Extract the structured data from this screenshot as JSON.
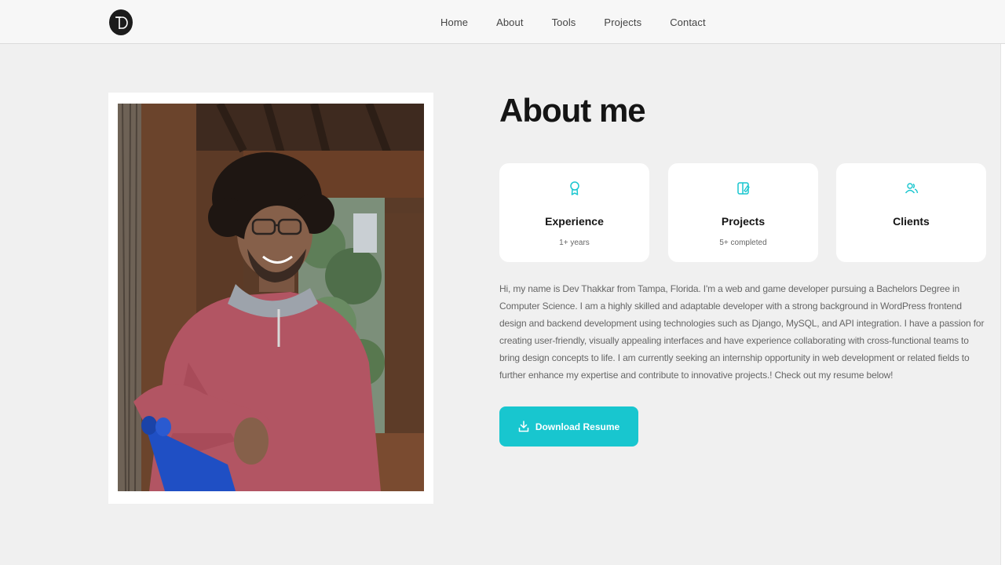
{
  "nav": {
    "logo_text": "D",
    "links": [
      "Home",
      "About",
      "Tools",
      "Projects",
      "Contact"
    ]
  },
  "about": {
    "title": "About me",
    "cards": [
      {
        "icon": "award-icon",
        "title": "Experience",
        "subtitle": "1+ years"
      },
      {
        "icon": "projects-icon",
        "title": "Projects",
        "subtitle": "5+ completed"
      },
      {
        "icon": "users-icon",
        "title": "Clients",
        "subtitle": ""
      }
    ],
    "bio": "Hi, my name is Dev Thakkar from Tampa, Florida. I'm a web and game developer pursuing a Bachelors Degree in Computer Science. I am a highly skilled and adaptable developer with a strong background in WordPress frontend design and backend development using technologies such as Django, MySQL, and API integration. I have a passion for creating user-friendly, visually appealing interfaces and have experience collaborating with cross-functional teams to bring design concepts to life. I am currently seeking an internship opportunity in web development or related fields to further enhance my expertise and contribute to innovative projects.! Check out my resume below!",
    "button_label": "Download Resume"
  },
  "colors": {
    "accent": "#18c6cf",
    "background": "#f0f0f0",
    "card": "#ffffff",
    "heading": "#151515"
  }
}
